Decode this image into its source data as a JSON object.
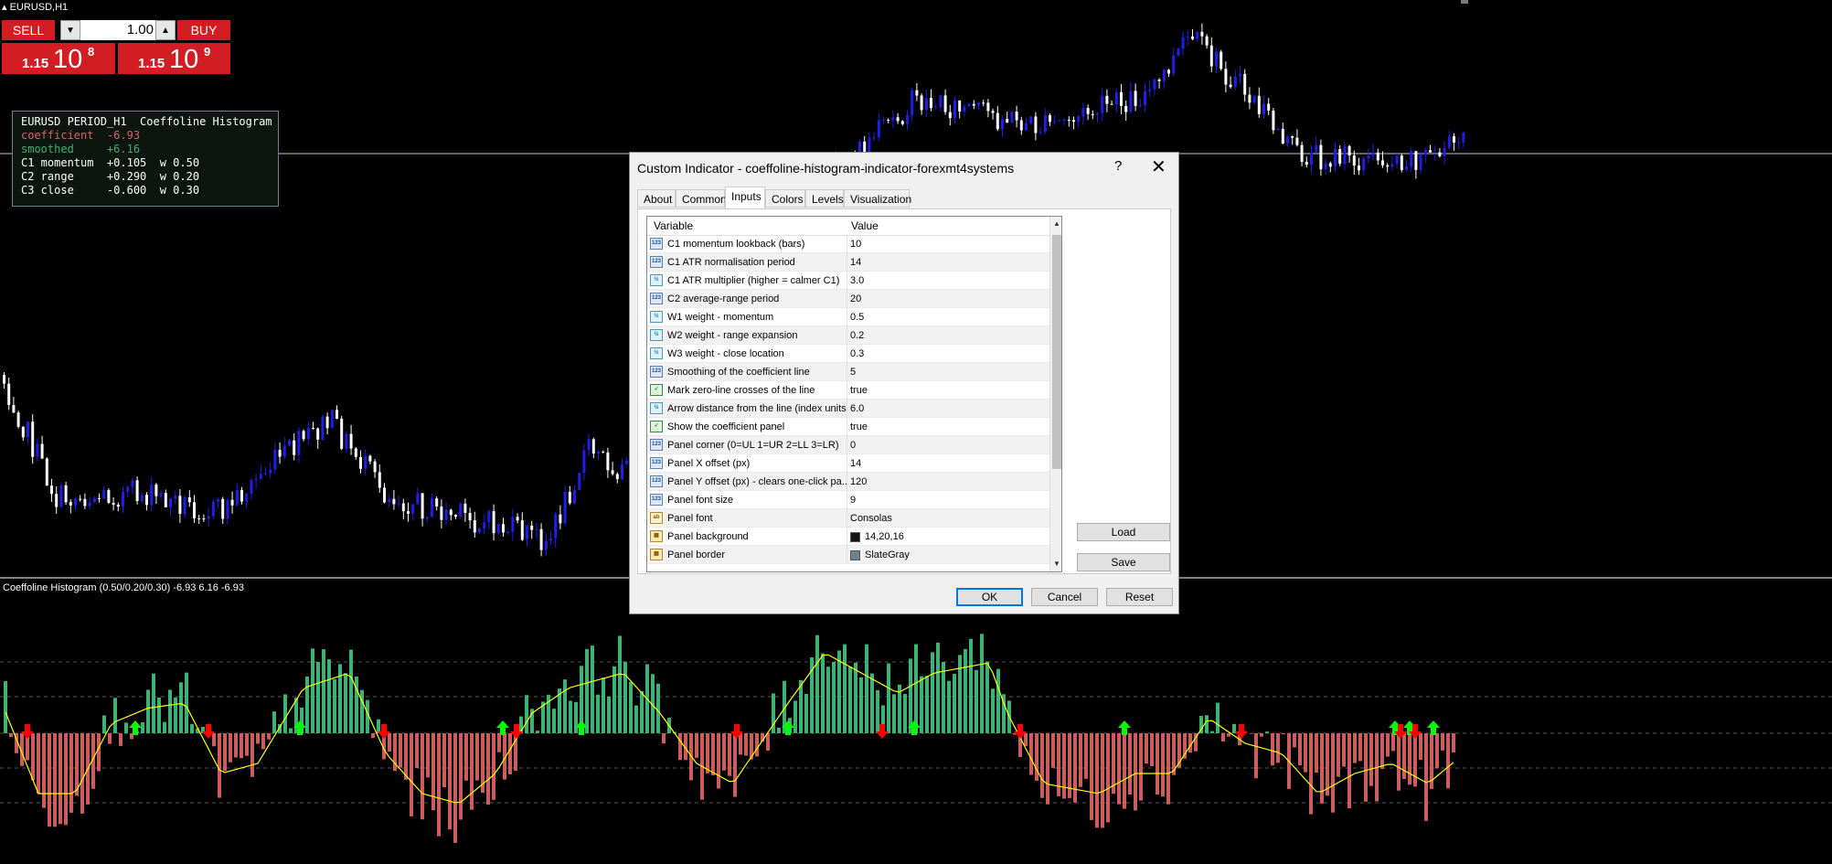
{
  "chart": {
    "symbol_label": "EURUSD,H1",
    "indicator_label": "Coeffoline Histogram (0.50/0.20/0.30) -6.93 6.16 -6.93"
  },
  "one_click": {
    "sell_label": "SELL",
    "buy_label": "BUY",
    "lot_value": "1.00",
    "sell_price_prefix": "1.15",
    "sell_price_big": "10",
    "sell_price_sup": "8",
    "buy_price_prefix": "1.15",
    "buy_price_big": "10",
    "buy_price_sup": "9"
  },
  "coef_panel": {
    "line1": "EURUSD PERIOD_H1  Coeffoline Histogram",
    "line2": "coefficient  -6.93",
    "line3": "smoothed     +6.16",
    "line4": "C1 momentum  +0.105  w 0.50",
    "line5": "C2 range     +0.290  w 0.20",
    "line6": "C3 close     -0.600  w 0.30",
    "coefficient_color": "#e06060",
    "smoothed_color": "#3cb371"
  },
  "dialog": {
    "title": "Custom Indicator - coeffoline-histogram-indicator-forexmt4systems",
    "help": "?",
    "close": "✕",
    "tabs": [
      "About",
      "Common",
      "Inputs",
      "Colors",
      "Levels",
      "Visualization"
    ],
    "active_tab": "Inputs",
    "col_variable": "Variable",
    "col_value": "Value",
    "rows": [
      {
        "type": "int",
        "icon": "123",
        "variable": "C1 momentum lookback (bars)",
        "value": "10"
      },
      {
        "type": "int",
        "icon": "123",
        "variable": "C1 ATR normalisation period",
        "value": "14"
      },
      {
        "type": "dbl",
        "icon": "½",
        "variable": "C1 ATR multiplier (higher = calmer C1)",
        "value": "3.0"
      },
      {
        "type": "int",
        "icon": "123",
        "variable": "C2 average-range period",
        "value": "20"
      },
      {
        "type": "dbl",
        "icon": "½",
        "variable": "W1 weight - momentum",
        "value": "0.5"
      },
      {
        "type": "dbl",
        "icon": "½",
        "variable": "W2 weight - range expansion",
        "value": "0.2"
      },
      {
        "type": "dbl",
        "icon": "½",
        "variable": "W3 weight - close location",
        "value": "0.3"
      },
      {
        "type": "int",
        "icon": "123",
        "variable": "Smoothing of the coefficient line",
        "value": "5"
      },
      {
        "type": "bool",
        "icon": "✓",
        "variable": "Mark zero-line crosses of the line",
        "value": "true"
      },
      {
        "type": "dbl",
        "icon": "½",
        "variable": "Arrow distance from the line (index units)",
        "value": "6.0"
      },
      {
        "type": "bool",
        "icon": "✓",
        "variable": "Show the coefficient panel",
        "value": "true"
      },
      {
        "type": "int",
        "icon": "123",
        "variable": "Panel corner (0=UL 1=UR 2=LL 3=LR)",
        "value": "0"
      },
      {
        "type": "int",
        "icon": "123",
        "variable": "Panel X offset (px)",
        "value": "14"
      },
      {
        "type": "int",
        "icon": "123",
        "variable": "Panel Y offset (px) - clears one-click pa...",
        "value": "120"
      },
      {
        "type": "int",
        "icon": "123",
        "variable": "Panel font size",
        "value": "9"
      },
      {
        "type": "str",
        "icon": "ab",
        "variable": "Panel font",
        "value": "Consolas"
      },
      {
        "type": "col",
        "icon": "▦",
        "variable": "Panel background",
        "value": "14,20,16",
        "swatch": "#0e1410"
      },
      {
        "type": "col",
        "icon": "▦",
        "variable": "Panel border",
        "value": "SlateGray",
        "swatch": "#708090"
      }
    ],
    "load": "Load",
    "save": "Save",
    "ok": "OK",
    "cancel": "Cancel",
    "reset": "Reset"
  },
  "colors": {
    "bull_candle": "#1e1ee6",
    "bear_candle": "#ffffff",
    "hist_positive": "#3cb371",
    "hist_negative": "#cd5c5c",
    "smooth_line": "#ffff00",
    "arrow_up": "#00ff00",
    "arrow_down": "#ff0000"
  }
}
